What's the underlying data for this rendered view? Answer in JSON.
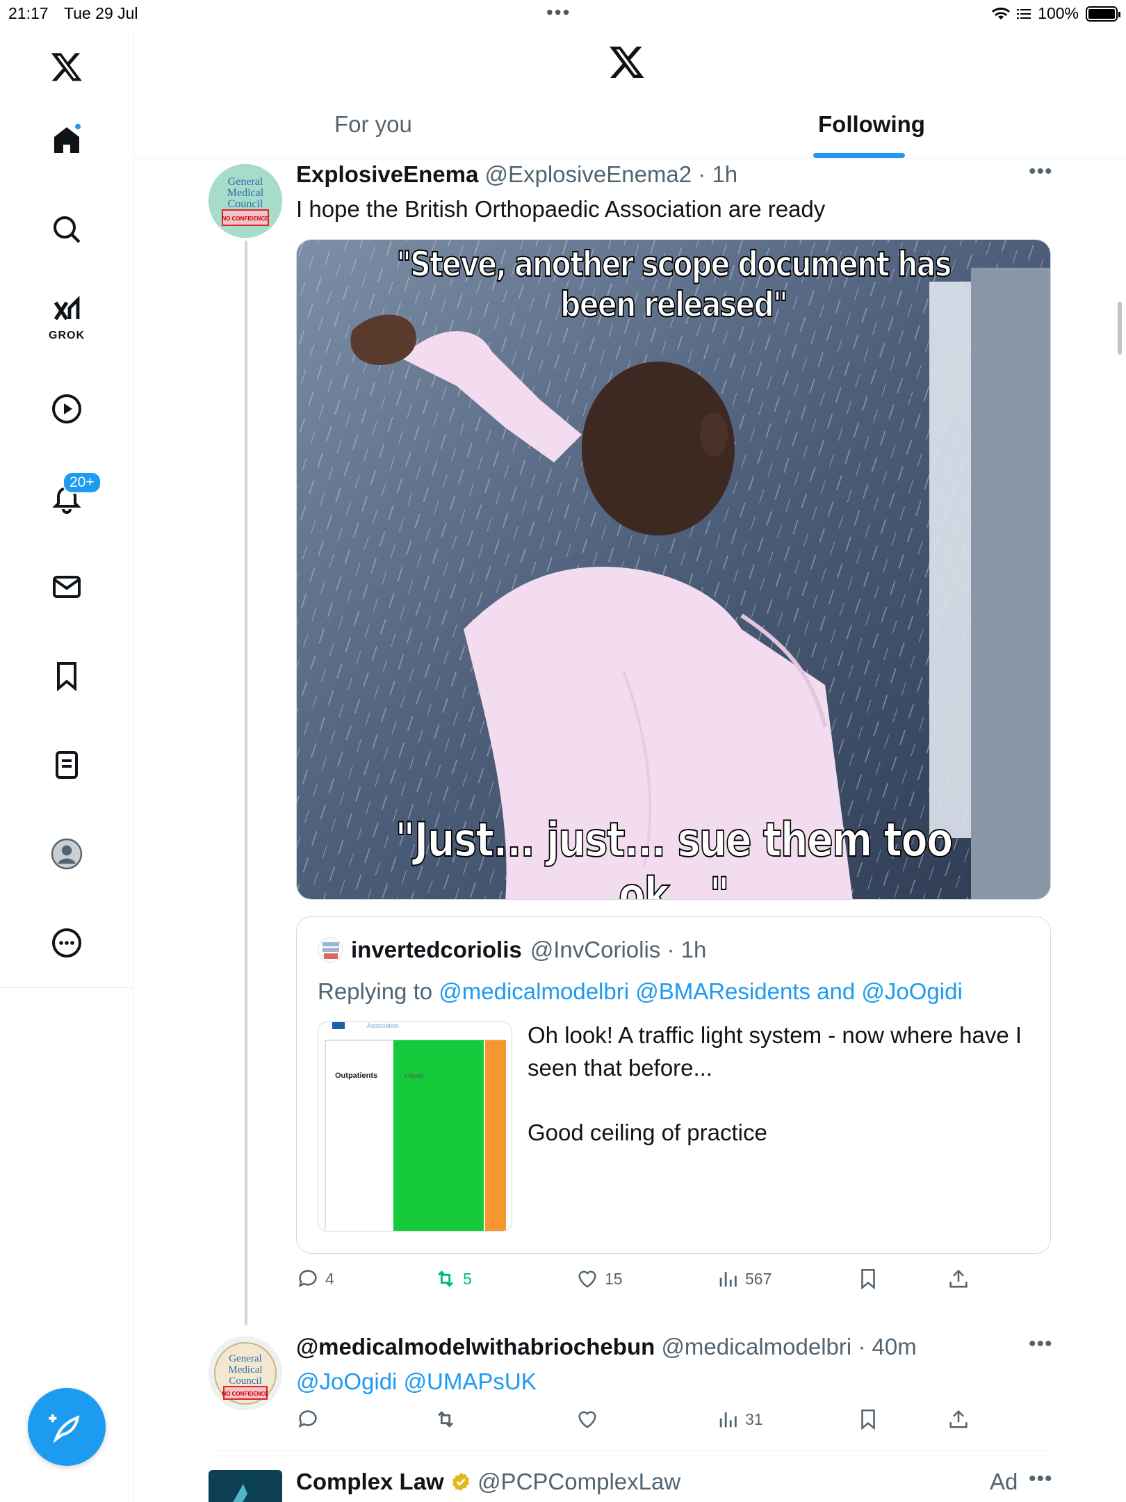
{
  "status_bar": {
    "time": "21:17",
    "date": "Tue 29 Jul",
    "battery": "100%"
  },
  "sidebar": {
    "grok_label": "GROK",
    "notifications_badge": "20+"
  },
  "header": {
    "tabs": [
      {
        "label": "For you",
        "active": false
      },
      {
        "label": "Following",
        "active": true
      }
    ]
  },
  "avatar_art": {
    "gmc_lines": [
      "General",
      "Medical",
      "Council"
    ],
    "gmc_stamp": "NO CONFIDENCE"
  },
  "tweet1": {
    "name": "ExplosiveEnema",
    "handle": "@ExplosiveEnema2",
    "time": "1h",
    "text": "I hope the British Orthopaedic Association are ready",
    "meme_top": "\"Steve, another scope document has been released\"",
    "meme_bottom": "\"Just... just... sue them too ok...\"",
    "quote": {
      "name": "invertedcoriolis",
      "handle": "@InvCoriolis",
      "time": "1h",
      "replying_to_prefix": "Replying to",
      "replying_to_1": "@medicalmodelbri",
      "replying_to_2": "@BMAResidents",
      "replying_and": "and",
      "replying_to_3": "@JoOgidi",
      "text_line1": "Oh look! A traffic light system - now where have I seen that before...",
      "text_line2": "Good ceiling of practice",
      "thumb_header": "Association",
      "thumb_row_label": "Outpatients",
      "thumb_cell": "• None."
    },
    "stats": {
      "replies": "4",
      "reposts": "5",
      "likes": "15",
      "views": "567"
    }
  },
  "tweet2": {
    "name": "@medicalmodelwithabriochebun",
    "handle": "@medicalmodelbri",
    "time": "40m",
    "mention1": "@JoOgidi",
    "mention2": "@UMAPsUK",
    "stats": {
      "views": "31"
    }
  },
  "tweet3": {
    "name": "Complex Law",
    "handle": "@PCPComplexLaw",
    "ad_label": "Ad"
  },
  "colors": {
    "accent": "#1d9bf0",
    "repost": "#00ba7c",
    "text": "#0f1419",
    "muted": "#536471"
  }
}
